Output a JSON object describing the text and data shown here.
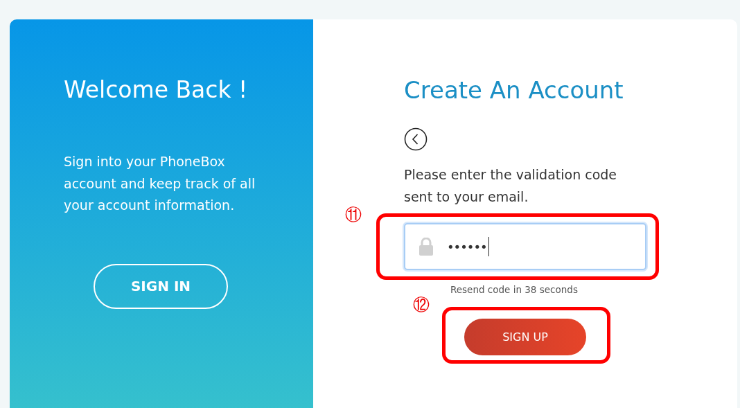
{
  "left_panel": {
    "title": "Welcome Back !",
    "text": "Sign into your PhoneBox account and keep track of all your account information.",
    "button": "SIGN IN"
  },
  "right_panel": {
    "title": "Create An Account",
    "instruction": "Please enter the validation code sent to your email.",
    "code_field": {
      "value": "••••••",
      "focused": true
    },
    "resend_text": "Resend code in 38 seconds",
    "button": "SIGN UP"
  },
  "annotations": [
    {
      "label": "⑪"
    },
    {
      "label": "⑫"
    }
  ]
}
